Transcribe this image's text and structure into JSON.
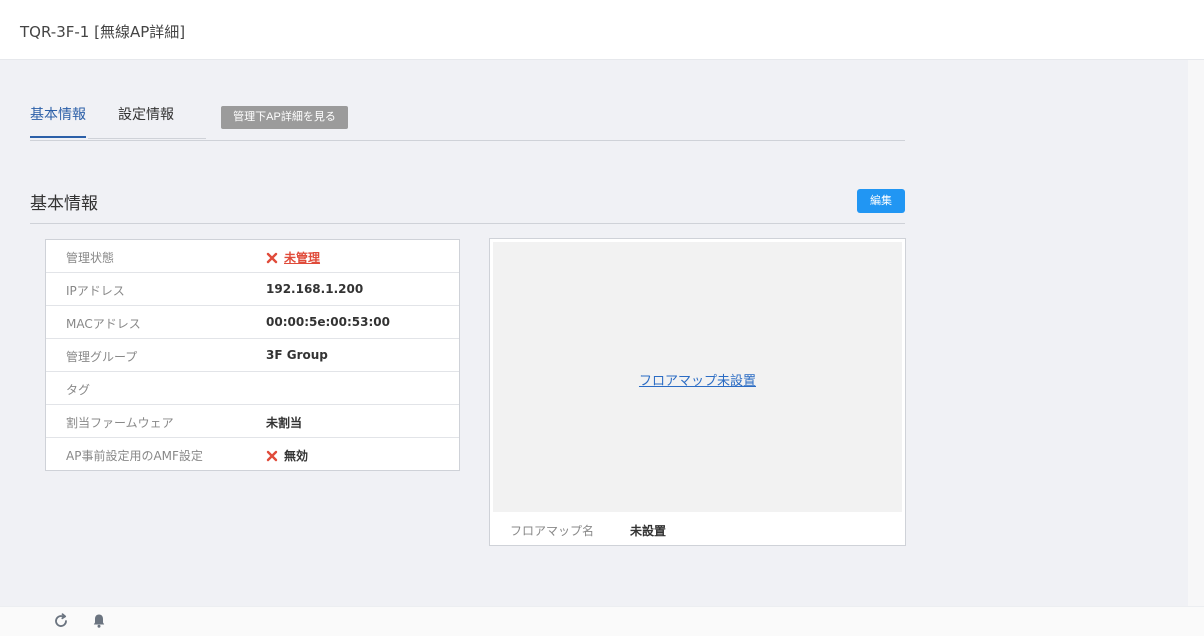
{
  "header": {
    "title": "TQR-3F-1 [無線AP詳細]"
  },
  "tabs": [
    {
      "label": "基本情報",
      "active": true
    },
    {
      "label": "設定情報",
      "active": false
    }
  ],
  "ap_detail_button": "管理下AP詳細を見る",
  "section": {
    "title": "基本情報",
    "edit_label": "編集"
  },
  "info_rows": [
    {
      "label": "管理状態",
      "value": "未管理",
      "icon": "x-icon",
      "style": "red-link"
    },
    {
      "label": "IPアドレス",
      "value": "192.168.1.200"
    },
    {
      "label": "MACアドレス",
      "value": "00:00:5e:00:53:00"
    },
    {
      "label": "管理グループ",
      "value": "3F Group"
    },
    {
      "label": "タグ",
      "value": ""
    },
    {
      "label": "割当ファームウェア",
      "value": "未割当"
    },
    {
      "label": "AP事前設定用のAMF設定",
      "value": "無効",
      "icon": "x-icon"
    }
  ],
  "floor_map": {
    "link_text": "フロアマップ未設置",
    "name_label": "フロアマップ名",
    "name_value": "未設置"
  },
  "footer": {
    "icons": [
      "refresh-icon",
      "bell-icon"
    ]
  },
  "colors": {
    "accent": "#2196f3",
    "error": "#e04b3a",
    "tab_active": "#2b5fa8"
  }
}
